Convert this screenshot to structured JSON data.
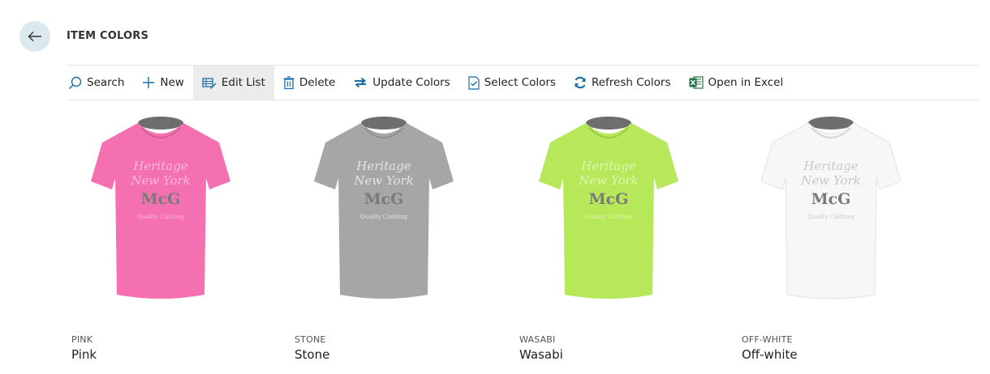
{
  "page": {
    "title": "ITEM COLORS",
    "back_icon": "arrow-left-icon"
  },
  "toolbar": [
    {
      "label": "Search",
      "icon": "search-icon"
    },
    {
      "label": "New",
      "icon": "plus-icon"
    },
    {
      "label": "Edit List",
      "icon": "edit-list-icon",
      "active": true
    },
    {
      "label": "Delete",
      "icon": "trash-icon"
    },
    {
      "label": "Update Colors",
      "icon": "sync-arrows-icon"
    },
    {
      "label": "Select Colors",
      "icon": "select-document-icon"
    },
    {
      "label": "Refresh Colors",
      "icon": "refresh-icon"
    },
    {
      "label": "Open in Excel",
      "icon": "excel-icon"
    }
  ],
  "items": [
    {
      "code": "PINK",
      "description": "Pink",
      "shirt_color": "#f470b0",
      "print_color": "#f9b9d8"
    },
    {
      "code": "STONE",
      "description": "Stone",
      "shirt_color": "#a6a6a6",
      "print_color": "#e3e3e3"
    },
    {
      "code": "WASABI",
      "description": "Wasabi",
      "shirt_color": "#b7e85a",
      "print_color": "#dff5b0"
    },
    {
      "code": "OFF-WHITE",
      "description": "Off-white",
      "shirt_color": "#f7f7f7",
      "print_color": "#c8c8c8"
    }
  ],
  "colors": {
    "accent": "#1b6ea8",
    "back_button_bg": "#dbe9ef",
    "excel_green": "#1e7145"
  }
}
